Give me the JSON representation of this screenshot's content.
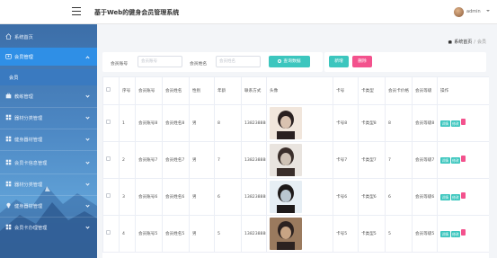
{
  "header": {
    "title": "基于Web的健身会员管理系统",
    "username": "admin"
  },
  "sidebar": {
    "items": [
      {
        "label": "系统首页",
        "icon": "home-icon"
      },
      {
        "label": "会员管理",
        "icon": "user-group-icon",
        "active": true
      },
      {
        "label": "教练管理",
        "icon": "briefcase-icon"
      },
      {
        "label": "器材分类管理",
        "icon": "grid-icon"
      },
      {
        "label": "健身器材管理",
        "icon": "grid-icon"
      },
      {
        "label": "会员卡信息管理",
        "icon": "grid-icon"
      },
      {
        "label": "器材分类管理",
        "icon": "grid-icon"
      },
      {
        "label": "健身器材管理",
        "icon": "bulb-icon"
      },
      {
        "label": "会员卡办理管理",
        "icon": "grid-icon"
      }
    ],
    "sub_item": "会员"
  },
  "breadcrumb": {
    "home": "系统首页",
    "separator": "/",
    "current": "会员"
  },
  "search": {
    "account_label": "会员账号",
    "account_placeholder": "会员账号",
    "name_label": "会员姓名",
    "name_placeholder": "会员姓名",
    "query_button": "查询数据"
  },
  "actions": {
    "add": "新增",
    "delete": "删除"
  },
  "table": {
    "headers": [
      "",
      "序号",
      "会员账号",
      "会员姓名",
      "性别",
      "年龄",
      "联系方式",
      "头像",
      "卡号",
      "卡类型",
      "会员卡价格",
      "会员等级",
      "操作"
    ],
    "rows": [
      {
        "index": "1",
        "account": "会员账号8",
        "name": "会员姓名8",
        "gender": "男",
        "age": "8",
        "phone": "13823888888",
        "avatar_tone": [
          "#f1e6dc",
          "#2a2020",
          "#d9c2b0"
        ],
        "card_no": "卡号8",
        "card_type": "卡类型8",
        "price": "8",
        "level": "会员等级8"
      },
      {
        "index": "2",
        "account": "会员账号7",
        "name": "会员姓名7",
        "gender": "男",
        "age": "7",
        "phone": "13823888887",
        "avatar_tone": [
          "#e9e4df",
          "#3a2e2a",
          "#cfc2b5"
        ],
        "card_no": "卡号7",
        "card_type": "卡类型7",
        "price": "7",
        "level": "会员等级7"
      },
      {
        "index": "3",
        "account": "会员账号6",
        "name": "会员姓名6",
        "gender": "男",
        "age": "6",
        "phone": "13823888886",
        "avatar_tone": [
          "#e6eef4",
          "#1e1a1a",
          "#b9c6d0"
        ],
        "card_no": "卡号6",
        "card_type": "卡类型6",
        "price": "6",
        "level": "会员等级6"
      },
      {
        "index": "4",
        "account": "会员账号5",
        "name": "会员姓名5",
        "gender": "男",
        "age": "5",
        "phone": "13823888885",
        "avatar_tone": [
          "#9a7a5e",
          "#2c2220",
          "#c8a484"
        ],
        "card_no": "卡号5",
        "card_type": "卡类型5",
        "price": "5",
        "level": "会员等级5"
      }
    ],
    "op_detail": "详情",
    "op_edit": "修改",
    "op_delete": ""
  },
  "colors": {
    "accent": "#3cc6be",
    "danger": "#f3528d",
    "sidebar_active": "#2f8fe6"
  }
}
